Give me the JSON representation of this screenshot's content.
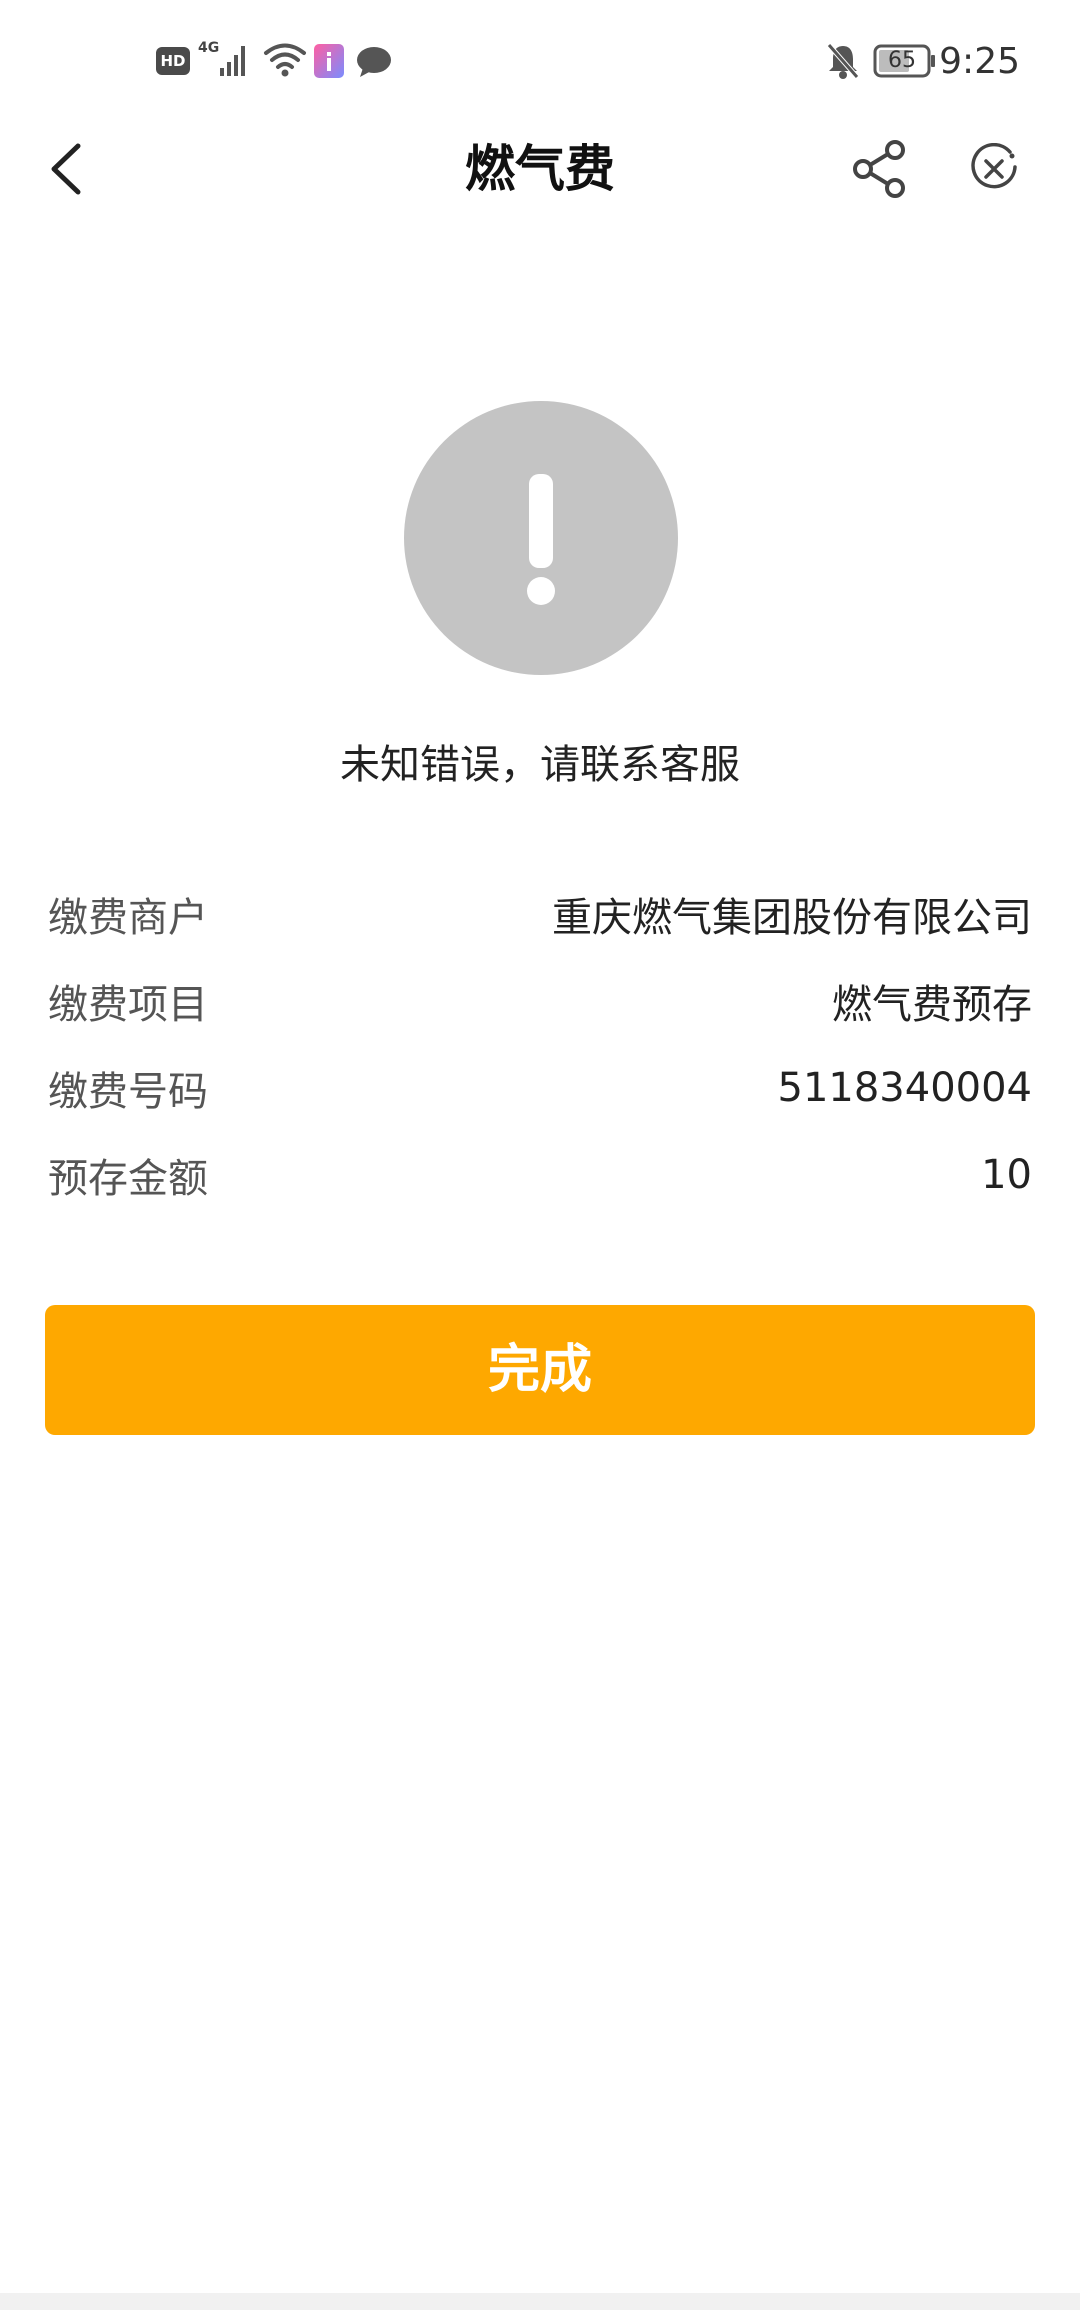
{
  "status_bar": {
    "hd_badge": "HD",
    "network": "4G",
    "battery": "65",
    "time": "9:25",
    "icons": [
      "hd-icon",
      "signal-icon",
      "wifi-icon",
      "app-notification-icon",
      "message-icon",
      "mute-bell-icon",
      "battery-icon"
    ]
  },
  "nav": {
    "title": "燃气费",
    "icons": [
      "back-icon",
      "share-icon",
      "close-icon"
    ]
  },
  "result": {
    "icon": "exclamation-icon",
    "icon_color": "#c4c4c4",
    "message": "未知错误，请联系客服"
  },
  "details": [
    {
      "label": "缴费商户",
      "value": "重庆燃气集团股份有限公司"
    },
    {
      "label": "缴费项目",
      "value": "燃气费预存"
    },
    {
      "label": "缴费号码",
      "value": "5118340004"
    },
    {
      "label": "预存金额",
      "value": "10"
    }
  ],
  "done_button": {
    "label": "完成",
    "color": "#fea800"
  }
}
